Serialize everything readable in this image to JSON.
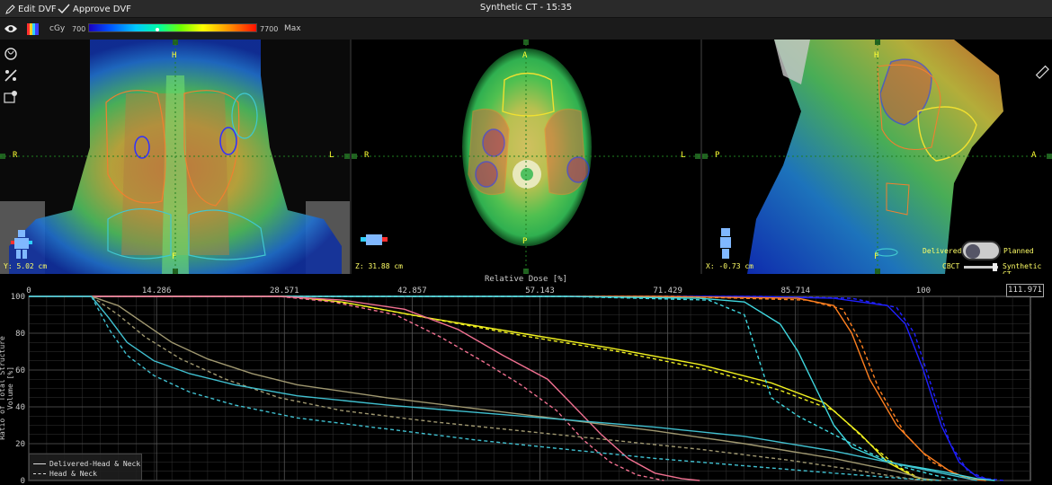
{
  "topbar": {
    "edit_dvf": "Edit DVF",
    "approve_dvf": "Approve DVF",
    "title": "Synthetic CT - 15:35"
  },
  "toolbar": {
    "unit": "cGy",
    "min_value": "700",
    "max_value": "7700",
    "max_label": "Max"
  },
  "views": {
    "coronal": {
      "top": "H",
      "bottom": "F",
      "left": "R",
      "right": "L",
      "coord": "Y: 5.02 cm"
    },
    "axial": {
      "top": "A",
      "bottom": "P",
      "left": "R",
      "right": "L",
      "coord": "Z: 31.88 cm"
    },
    "sagittal": {
      "top": "H",
      "bottom": "F",
      "left": "P",
      "right": "A",
      "coord": "X: -0.73 cm"
    }
  },
  "toggles": {
    "delivered": "Delivered",
    "planned": "Planned",
    "cbct": "CBCT",
    "synthetic": "Synthetic CT"
  },
  "dvh": {
    "x_title": "Relative Dose [%]",
    "y_title": "Ratio of Total Structure Volume [%]",
    "max_box": "111.971",
    "legend_solid": "Delivered-Head & Neck",
    "legend_dashed": "Head & Neck"
  },
  "chart_data": {
    "type": "line",
    "xlabel": "Relative Dose [%]",
    "ylabel": "Ratio of Total Structure Volume [%]",
    "xlim": [
      0,
      111.971
    ],
    "ylim": [
      0,
      100
    ],
    "x_ticks": [
      "0",
      "14.286",
      "28.571",
      "42.857",
      "57.143",
      "71.429",
      "85.714",
      "100"
    ],
    "y_ticks": [
      "0",
      "20",
      "40",
      "60",
      "80",
      "100"
    ],
    "grid": true,
    "legend_position": "bottom-left",
    "series": [
      {
        "color": "#2020ff",
        "dash": false,
        "points": [
          [
            0,
            100
          ],
          [
            80,
            100
          ],
          [
            90,
            99
          ],
          [
            96,
            95
          ],
          [
            98,
            85
          ],
          [
            100,
            60
          ],
          [
            102,
            30
          ],
          [
            104,
            10
          ],
          [
            106,
            2
          ],
          [
            108,
            0
          ]
        ]
      },
      {
        "color": "#2020ff",
        "dash": true,
        "points": [
          [
            0,
            100
          ],
          [
            82,
            100
          ],
          [
            92,
            99
          ],
          [
            97,
            94
          ],
          [
            99,
            80
          ],
          [
            101,
            50
          ],
          [
            103,
            20
          ],
          [
            105,
            5
          ],
          [
            107,
            1
          ],
          [
            109,
            0
          ]
        ]
      },
      {
        "color": "#ff8020",
        "dash": false,
        "points": [
          [
            0,
            100
          ],
          [
            70,
            100
          ],
          [
            86,
            99
          ],
          [
            90,
            95
          ],
          [
            92,
            80
          ],
          [
            94,
            55
          ],
          [
            97,
            30
          ],
          [
            100,
            15
          ],
          [
            103,
            5
          ],
          [
            105,
            1
          ],
          [
            107,
            0
          ]
        ]
      },
      {
        "color": "#ff8020",
        "dash": true,
        "points": [
          [
            0,
            100
          ],
          [
            72,
            100
          ],
          [
            87,
            98
          ],
          [
            91,
            93
          ],
          [
            93,
            75
          ],
          [
            95,
            50
          ],
          [
            98,
            25
          ],
          [
            101,
            10
          ],
          [
            104,
            3
          ],
          [
            106,
            0
          ]
        ]
      },
      {
        "color": "#f0f020",
        "dash": false,
        "points": [
          [
            0,
            100
          ],
          [
            29,
            100
          ],
          [
            35,
            97
          ],
          [
            45,
            88
          ],
          [
            55,
            80
          ],
          [
            65,
            72
          ],
          [
            75,
            63
          ],
          [
            83,
            53
          ],
          [
            89,
            42
          ],
          [
            93,
            25
          ],
          [
            96,
            10
          ],
          [
            99,
            2
          ],
          [
            101,
            0
          ]
        ]
      },
      {
        "color": "#f0f020",
        "dash": true,
        "points": [
          [
            0,
            100
          ],
          [
            29,
            100
          ],
          [
            36,
            96
          ],
          [
            46,
            87
          ],
          [
            56,
            78
          ],
          [
            66,
            70
          ],
          [
            76,
            60
          ],
          [
            84,
            49
          ],
          [
            90,
            38
          ],
          [
            94,
            20
          ],
          [
            97,
            8
          ],
          [
            100,
            0
          ]
        ]
      },
      {
        "color": "#40d8e0",
        "dash": false,
        "points": [
          [
            0,
            100
          ],
          [
            60,
            100
          ],
          [
            75,
            99
          ],
          [
            80,
            97
          ],
          [
            84,
            85
          ],
          [
            86,
            70
          ],
          [
            88,
            50
          ],
          [
            90,
            30
          ],
          [
            92,
            18
          ],
          [
            96,
            10
          ],
          [
            102,
            5
          ],
          [
            106,
            1
          ],
          [
            108,
            0
          ]
        ]
      },
      {
        "color": "#40d8e0",
        "dash": true,
        "points": [
          [
            0,
            100
          ],
          [
            60,
            100
          ],
          [
            76,
            98
          ],
          [
            80,
            90
          ],
          [
            82,
            60
          ],
          [
            83,
            45
          ],
          [
            86,
            35
          ],
          [
            90,
            25
          ],
          [
            94,
            15
          ],
          [
            98,
            7
          ],
          [
            102,
            2
          ],
          [
            104,
            0
          ]
        ]
      },
      {
        "color": "#f07090",
        "dash": false,
        "points": [
          [
            0,
            100
          ],
          [
            28,
            100
          ],
          [
            35,
            98
          ],
          [
            42,
            93
          ],
          [
            48,
            82
          ],
          [
            53,
            68
          ],
          [
            58,
            55
          ],
          [
            61,
            40
          ],
          [
            64,
            25
          ],
          [
            67,
            12
          ],
          [
            70,
            4
          ],
          [
            73,
            1
          ],
          [
            75,
            0
          ]
        ]
      },
      {
        "color": "#f07090",
        "dash": true,
        "points": [
          [
            0,
            100
          ],
          [
            28,
            100
          ],
          [
            34,
            97
          ],
          [
            41,
            90
          ],
          [
            46,
            78
          ],
          [
            51,
            64
          ],
          [
            55,
            52
          ],
          [
            59,
            38
          ],
          [
            62,
            22
          ],
          [
            65,
            10
          ],
          [
            68,
            3
          ],
          [
            71,
            0
          ]
        ]
      },
      {
        "color": "#a09870",
        "dash": false,
        "points": [
          [
            0,
            100
          ],
          [
            7,
            100
          ],
          [
            10,
            95
          ],
          [
            13,
            85
          ],
          [
            16,
            75
          ],
          [
            20,
            66
          ],
          [
            25,
            58
          ],
          [
            30,
            52
          ],
          [
            40,
            45
          ],
          [
            50,
            39
          ],
          [
            60,
            33
          ],
          [
            70,
            27
          ],
          [
            80,
            20
          ],
          [
            90,
            12
          ],
          [
            97,
            5
          ],
          [
            100,
            1
          ],
          [
            102,
            0
          ]
        ]
      },
      {
        "color": "#a09870",
        "dash": true,
        "points": [
          [
            0,
            100
          ],
          [
            7,
            100
          ],
          [
            10,
            90
          ],
          [
            13,
            78
          ],
          [
            17,
            66
          ],
          [
            22,
            55
          ],
          [
            28,
            45
          ],
          [
            35,
            38
          ],
          [
            45,
            32
          ],
          [
            55,
            27
          ],
          [
            65,
            22
          ],
          [
            75,
            17
          ],
          [
            85,
            11
          ],
          [
            92,
            6
          ],
          [
            97,
            2
          ],
          [
            100,
            0
          ]
        ]
      },
      {
        "color": "#40c0d0",
        "dash": false,
        "points": [
          [
            0,
            100
          ],
          [
            7,
            100
          ],
          [
            9,
            88
          ],
          [
            11,
            75
          ],
          [
            14,
            65
          ],
          [
            18,
            58
          ],
          [
            23,
            52
          ],
          [
            30,
            46
          ],
          [
            40,
            41
          ],
          [
            50,
            37
          ],
          [
            60,
            33
          ],
          [
            70,
            29
          ],
          [
            80,
            24
          ],
          [
            90,
            16
          ],
          [
            98,
            8
          ],
          [
            103,
            3
          ],
          [
            106,
            0
          ]
        ]
      },
      {
        "color": "#40c0d0",
        "dash": true,
        "points": [
          [
            0,
            100
          ],
          [
            7,
            100
          ],
          [
            9,
            82
          ],
          [
            11,
            68
          ],
          [
            14,
            57
          ],
          [
            18,
            48
          ],
          [
            23,
            41
          ],
          [
            30,
            34
          ],
          [
            40,
            28
          ],
          [
            50,
            22
          ],
          [
            60,
            17
          ],
          [
            70,
            12
          ],
          [
            80,
            8
          ],
          [
            90,
            4
          ],
          [
            98,
            1
          ],
          [
            102,
            0
          ]
        ]
      }
    ]
  }
}
